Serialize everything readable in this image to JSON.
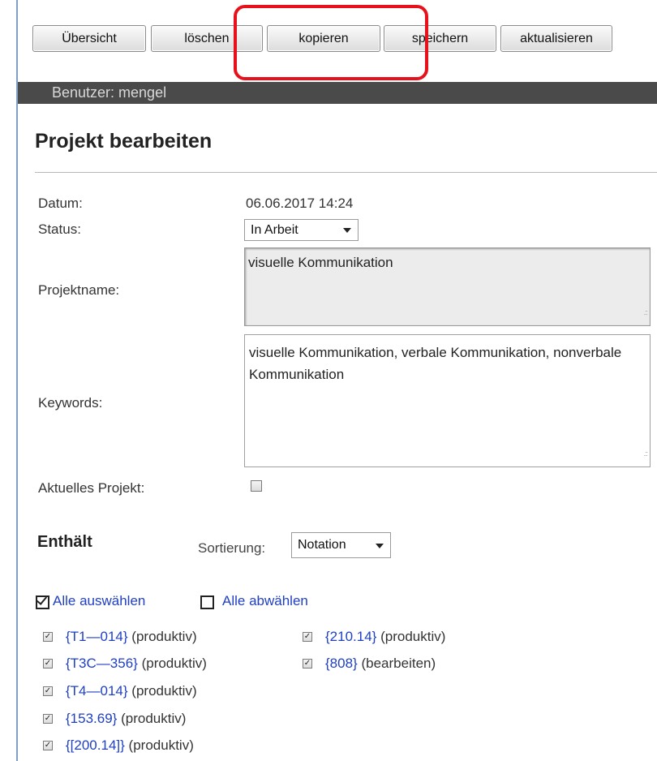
{
  "toolbar": {
    "overview_label": "Übersicht",
    "delete_label": "löschen",
    "copy_label": "kopieren",
    "save_label": "speichern",
    "refresh_label": "aktualisieren",
    "highlight_color": "#e8111b"
  },
  "user_bar": {
    "text": "Benutzer: mengel"
  },
  "page_title": "Projekt bearbeiten",
  "form": {
    "date_label": "Datum:",
    "date_value": "06.06.2017 14:24",
    "status_label": "Status:",
    "status_value": "In Arbeit",
    "project_name_label": "Projektname:",
    "project_name_value": "visuelle Kommunikation",
    "keywords_label": "Keywords:",
    "keywords_value": "visuelle Kommunikation, verbale Kommunikation, nonverbale Kommunikation",
    "current_project_label": "Aktuelles Projekt:",
    "current_project_checked": false
  },
  "contains": {
    "heading": "Enthält",
    "sort_label": "Sortierung:",
    "sort_value": "Notation",
    "select_all": "Alle auswählen",
    "deselect_all": "Alle abwählen",
    "items": [
      {
        "code": "{T1—014}",
        "state": "(produktiv)",
        "checked": true
      },
      {
        "code": "{T3C—356}",
        "state": "(produktiv)",
        "checked": true
      },
      {
        "code": "{T4—014}",
        "state": "(produktiv)",
        "checked": true
      },
      {
        "code": "{153.69}",
        "state": "(produktiv)",
        "checked": true
      },
      {
        "code": "{[200.14]}",
        "state": "(produktiv)",
        "checked": true
      },
      {
        "code": "{210.14}",
        "state": "(produktiv)",
        "checked": true
      },
      {
        "code": "{808}",
        "state": "(bearbeiten)",
        "checked": true
      }
    ]
  }
}
